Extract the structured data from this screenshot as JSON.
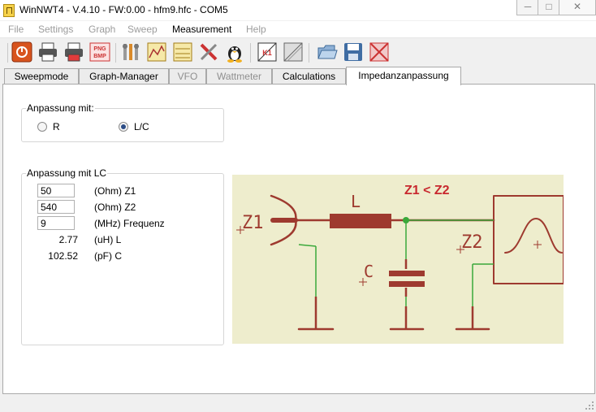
{
  "window": {
    "title": "WinNWT4 - V.4.10 - FW:0.00 - hfm9.hfc - COM5"
  },
  "window_buttons": {
    "minimize": "─",
    "maximize": "□",
    "close": "✕"
  },
  "menu": [
    "File",
    "Settings",
    "Graph",
    "Sweep",
    "Measurement",
    "Help"
  ],
  "toolbar": {
    "icons": [
      "power-icon",
      "printer-icon",
      "printer-color-icon",
      "png-bmp-export-icon",
      "tools-settings-icon",
      "graph-window-icon",
      "db-table-icon",
      "red-tools-icon",
      "tux-linux-icon",
      "k1-calibrate-icon",
      "calibrate-icon",
      "open-folder-icon",
      "save-icon",
      "grid-icon"
    ],
    "png_text_1": "PNG",
    "png_text_2": "BMP"
  },
  "tabs": [
    {
      "label": "Sweepmode",
      "state": "normal"
    },
    {
      "label": "Graph-Manager",
      "state": "normal"
    },
    {
      "label": "VFO",
      "state": "disabled"
    },
    {
      "label": "Wattmeter",
      "state": "disabled"
    },
    {
      "label": "Calculations",
      "state": "normal"
    },
    {
      "label": "Impedanzanpassung",
      "state": "active"
    }
  ],
  "anpassung": {
    "title": "Anpassung mit:",
    "options": [
      {
        "label": "R",
        "selected": false
      },
      {
        "label": "L/C",
        "selected": true
      }
    ]
  },
  "lc": {
    "title": "Anpassung mit LC",
    "inputs": [
      {
        "value": "50",
        "label": "(Ohm) Z1"
      },
      {
        "value": "540",
        "label": "(Ohm) Z2"
      },
      {
        "value": "9",
        "label": "(MHz) Frequenz"
      }
    ],
    "results": [
      {
        "value": "2.77",
        "label": "(uH) L"
      },
      {
        "value": "102.52",
        "label": "(pF) C"
      }
    ]
  },
  "diagram": {
    "bg": "#eeedcd",
    "stroke": "#9e3a2f",
    "red": "#c8282e",
    "wire_green": "#3aa83a",
    "relation": "Z1 < Z2",
    "z1": "Z1",
    "z2": "Z2",
    "l": "L",
    "c": "C"
  }
}
